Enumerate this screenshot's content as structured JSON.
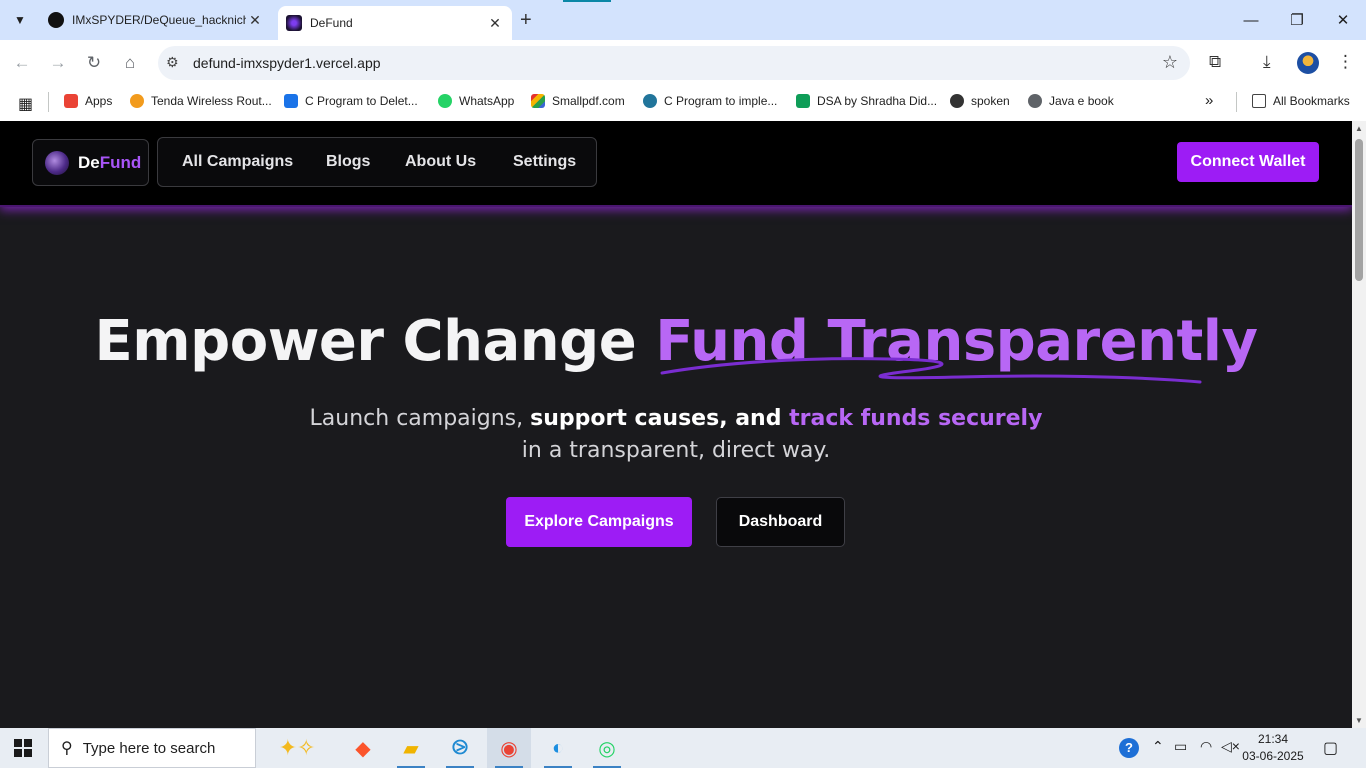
{
  "browser": {
    "tabs": [
      {
        "title": "IMxSPYDER/DeQueue_hacknich",
        "close": "✕"
      },
      {
        "title": "DeFund",
        "close": "✕"
      }
    ],
    "new_tab": "+",
    "url": "defund-imxspyder1.vercel.app",
    "window_controls": {
      "minimize": "—",
      "maximize": "❐",
      "close": "✕"
    },
    "bookmarks": [
      {
        "label": "Apps",
        "color": "#ea4335"
      },
      {
        "label": "Tenda Wireless Rout...",
        "color": "#f29b1d"
      },
      {
        "label": "C Program to Delet...",
        "color": "#1a73e8"
      },
      {
        "label": "WhatsApp",
        "color": "#25d366"
      },
      {
        "label": "Smallpdf.com",
        "color": "#e5322d"
      },
      {
        "label": "C Program to imple...",
        "color": "#21759b"
      },
      {
        "label": "DSA by Shradha Did...",
        "color": "#0f9d58"
      },
      {
        "label": "spoken",
        "color": "#333333"
      },
      {
        "label": "Java e book",
        "color": "#5f6368"
      }
    ],
    "bookmarks_more": "»",
    "all_bookmarks": "All Bookmarks"
  },
  "site": {
    "logo": {
      "part1": "De",
      "part2": "Fund"
    },
    "nav": [
      "All Campaigns",
      "Blogs",
      "About Us",
      "Settings"
    ],
    "connect_wallet": "Connect Wallet",
    "hero": {
      "title_plain": "Empower Change ",
      "title_accent": "Fund Transparently",
      "sub_part1": "Launch campaigns, ",
      "sub_strong": "support causes, and ",
      "sub_accent": "track funds securely",
      "sub_part2": " in a transparent, direct way."
    },
    "buttons": {
      "explore": "Explore Campaigns",
      "dashboard": "Dashboard"
    },
    "accent_color": "#9d1cf5"
  },
  "taskbar": {
    "search_placeholder": "Type here to search",
    "time": "21:34",
    "date": "03-06-2025"
  }
}
